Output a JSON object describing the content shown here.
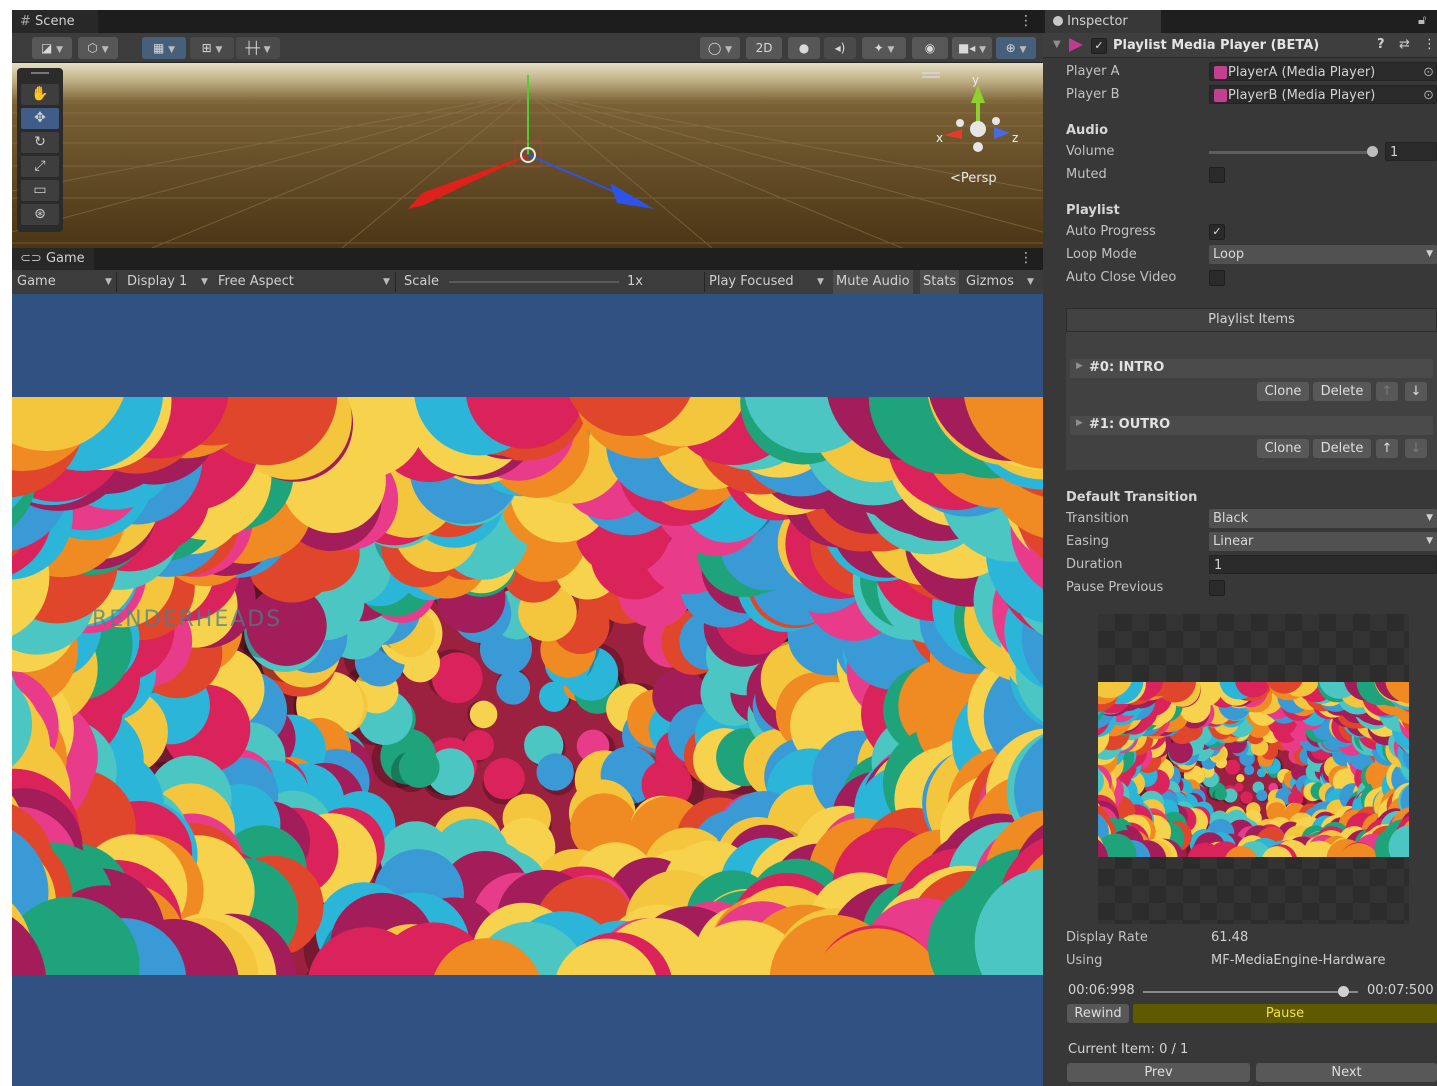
{
  "scene": {
    "tab_label": "Scene",
    "axis_x": "x",
    "axis_y": "y",
    "axis_z": "z",
    "projection_label": "Persp",
    "mode_2d": "2D"
  },
  "game": {
    "tab_label": "Game",
    "toolbar": {
      "view_dropdown": "Game",
      "display_dropdown": "Display 1",
      "aspect_dropdown": "Free Aspect",
      "scale_label": "Scale",
      "scale_value": "1x",
      "play_mode_dropdown": "Play Focused",
      "mute_audio": "Mute Audio",
      "stats": "Stats",
      "gizmos": "Gizmos"
    },
    "watermark": "RENDERHEADS"
  },
  "inspector": {
    "tab_label": "Inspector",
    "component_title": "Playlist Media Player (BETA)",
    "player_a_label": "Player A",
    "player_a_value": "PlayerA (Media Player)",
    "player_b_label": "Player B",
    "player_b_value": "PlayerB (Media Player)",
    "audio": {
      "header": "Audio",
      "volume_label": "Volume",
      "volume_value": "1",
      "volume_fraction": 1.0,
      "muted_label": "Muted",
      "muted": false
    },
    "playlist": {
      "header": "Playlist",
      "auto_progress_label": "Auto Progress",
      "auto_progress": true,
      "loop_mode_label": "Loop Mode",
      "loop_mode_value": "Loop",
      "auto_close_label": "Auto Close Video",
      "auto_close": false,
      "items_header": "Playlist Items",
      "items": [
        {
          "label": "#0: INTRO",
          "clone": "Clone",
          "delete": "Delete"
        },
        {
          "label": "#1: OUTRO",
          "clone": "Clone",
          "delete": "Delete"
        }
      ]
    },
    "transition": {
      "header": "Default Transition",
      "transition_label": "Transition",
      "transition_value": "Black",
      "easing_label": "Easing",
      "easing_value": "Linear",
      "duration_label": "Duration",
      "duration_value": "1",
      "pause_previous_label": "Pause Previous",
      "pause_previous": false
    },
    "stats": {
      "display_rate_label": "Display Rate",
      "display_rate_value": "61.48",
      "using_label": "Using",
      "using_value": "MF-MediaEngine-Hardware"
    },
    "playback": {
      "current_time": "00:06:998",
      "total_time": "00:07:500",
      "progress_fraction": 0.93,
      "rewind": "Rewind",
      "pause": "Pause",
      "current_item": "Current Item: 0 / 1",
      "prev": "Prev",
      "next": "Next"
    }
  },
  "colors": {
    "accent_selected": "#46607c",
    "pause_button": "#5f5a00",
    "game_background": "#305181"
  }
}
